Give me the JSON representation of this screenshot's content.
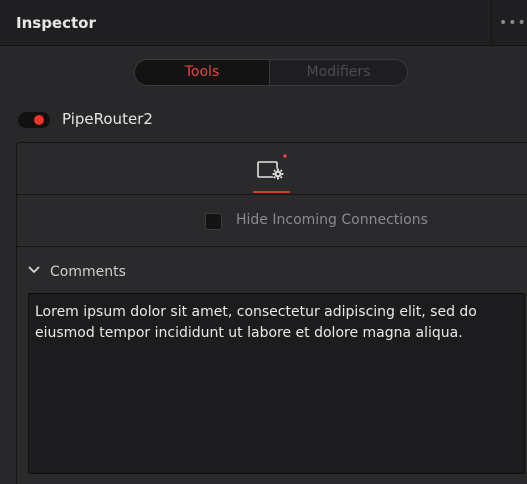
{
  "header": {
    "title": "Inspector",
    "more_icon": "more-dots-icon"
  },
  "tabs": [
    {
      "label": "Tools",
      "active": true
    },
    {
      "label": "Modifiers",
      "active": false
    }
  ],
  "node": {
    "enabled": true,
    "name": "PipeRouter2"
  },
  "control_tabs": [
    {
      "icon": "settings-tab-icon",
      "active": true,
      "has_indicator": true
    }
  ],
  "controls": {
    "hide_incoming": {
      "label": "Hide Incoming Connections",
      "checked": false
    }
  },
  "comments": {
    "header": "Comments",
    "expanded": true,
    "text": "Lorem ipsum dolor sit amet, consectetur adipiscing elit, sed do eiusmod tempor incididunt ut labore et dolore magna aliqua."
  },
  "colors": {
    "accent_red": "#e9453f",
    "panel_bg": "#28282b",
    "header_bg": "#1f1f21"
  }
}
